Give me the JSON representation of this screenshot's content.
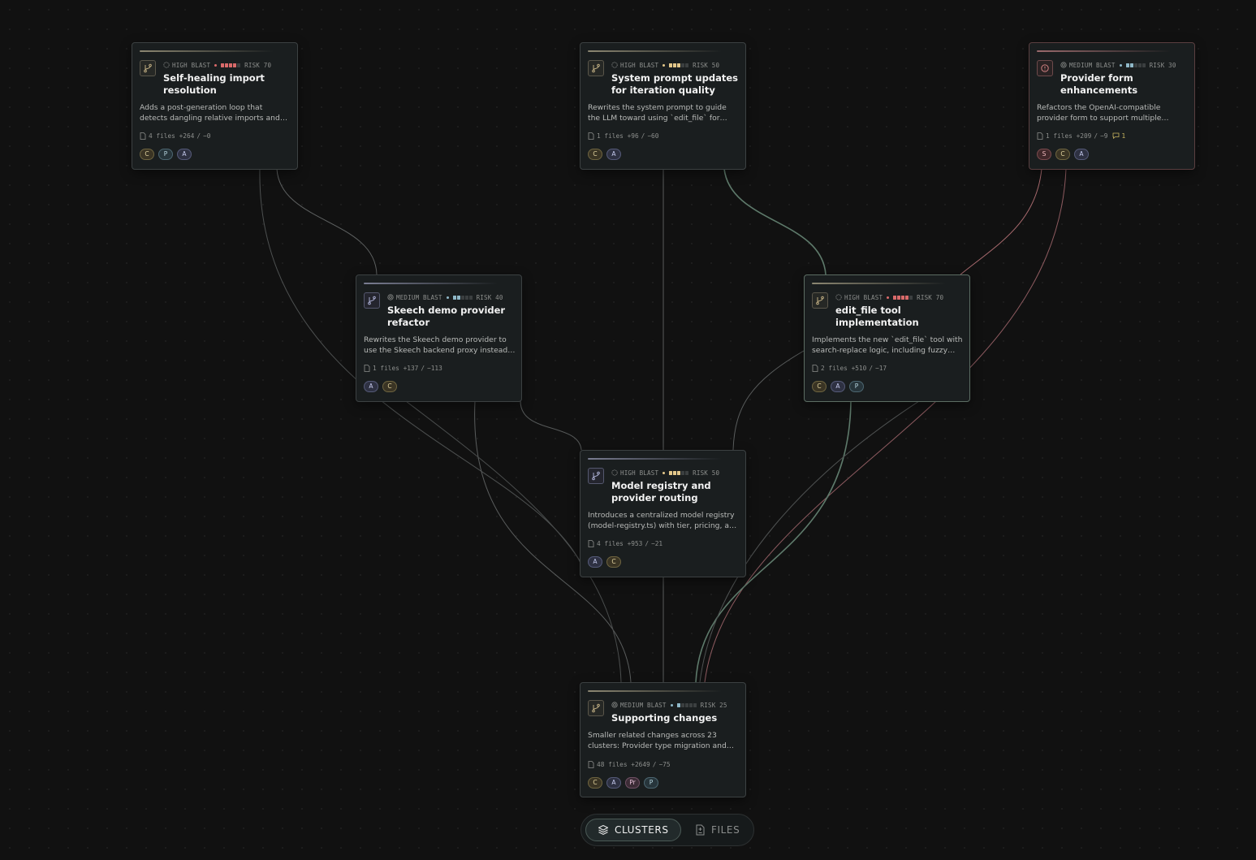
{
  "cards": [
    {
      "id": "self-healing",
      "blast": "HIGH BLAST",
      "risk": "RISK 70",
      "risk_level": 4,
      "risk_color": "#d96a6a",
      "title": "Self-healing import resolution",
      "description": "Adds a post-generation loop that detects dangling relative imports and prompts the LLM to resolve them.",
      "files": "4 files",
      "added": "+264",
      "removed": "−0",
      "chips": [
        "C",
        "P",
        "A"
      ]
    },
    {
      "id": "system-prompt",
      "blast": "HIGH BLAST",
      "risk": "RISK 50",
      "risk_level": 3,
      "risk_color": "#e3c78a",
      "title": "System prompt updates for iteration quality",
      "description": "Rewrites the system prompt to guide the LLM toward using `edit_file` for targeted changes.",
      "files": "1 files",
      "added": "+96",
      "removed": "−60",
      "chips": [
        "C",
        "A"
      ]
    },
    {
      "id": "provider-form",
      "blast": "MEDIUM BLAST",
      "risk": "RISK 30",
      "risk_level": 2,
      "risk_color": "#8fb8c8",
      "title": "Provider form enhancements",
      "description": "Refactors the OpenAI-compatible provider form to support multiple presets.",
      "files": "1 files",
      "added": "+209",
      "removed": "−9",
      "comments": "1",
      "chips": [
        "S",
        "C",
        "A"
      ]
    },
    {
      "id": "skeech-demo",
      "blast": "MEDIUM BLAST",
      "risk": "RISK 40",
      "risk_level": 2,
      "risk_color": "#8fb8c8",
      "title": "Skeech demo provider refactor",
      "description": "Rewrites the Skeech demo provider to use the Skeech backend proxy instead of direct calls.",
      "files": "1 files",
      "added": "+137",
      "removed": "−113",
      "chips": [
        "A",
        "C"
      ]
    },
    {
      "id": "edit-file",
      "blast": "HIGH BLAST",
      "risk": "RISK 70",
      "risk_level": 4,
      "risk_color": "#d96a6a",
      "title": "edit_file tool implementation",
      "description": "Implements the new `edit_file` tool with search-replace logic, including fuzzy matching.",
      "files": "2 files",
      "added": "+510",
      "removed": "−17",
      "chips": [
        "C",
        "A",
        "P"
      ]
    },
    {
      "id": "model-registry",
      "blast": "HIGH BLAST",
      "risk": "RISK 50",
      "risk_level": 3,
      "risk_color": "#e3c78a",
      "title": "Model registry and provider routing",
      "description": "Introduces a centralized model registry (model-registry.ts) with tier, pricing, and routing data.",
      "files": "4 files",
      "added": "+953",
      "removed": "−21",
      "chips": [
        "A",
        "C"
      ]
    },
    {
      "id": "supporting",
      "blast": "MEDIUM BLAST",
      "risk": "RISK 25",
      "risk_level": 1,
      "risk_color": "#8fb8c8",
      "title": "Supporting changes",
      "description": "Smaller related changes across 23 clusters: Provider type migration and more.",
      "files": "48 files",
      "added": "+2649",
      "removed": "−75",
      "chips": [
        "C",
        "A",
        "Pr",
        "P"
      ]
    }
  ],
  "view_toggle": {
    "clusters_label": "CLUSTERS",
    "files_label": "FILES",
    "active": "clusters"
  },
  "colors": {
    "background": "#111111",
    "card": "#1a1e1f",
    "edge": "#5a5e5e",
    "edge_green": "#5e7a6b",
    "edge_red": "#a86a6e"
  }
}
